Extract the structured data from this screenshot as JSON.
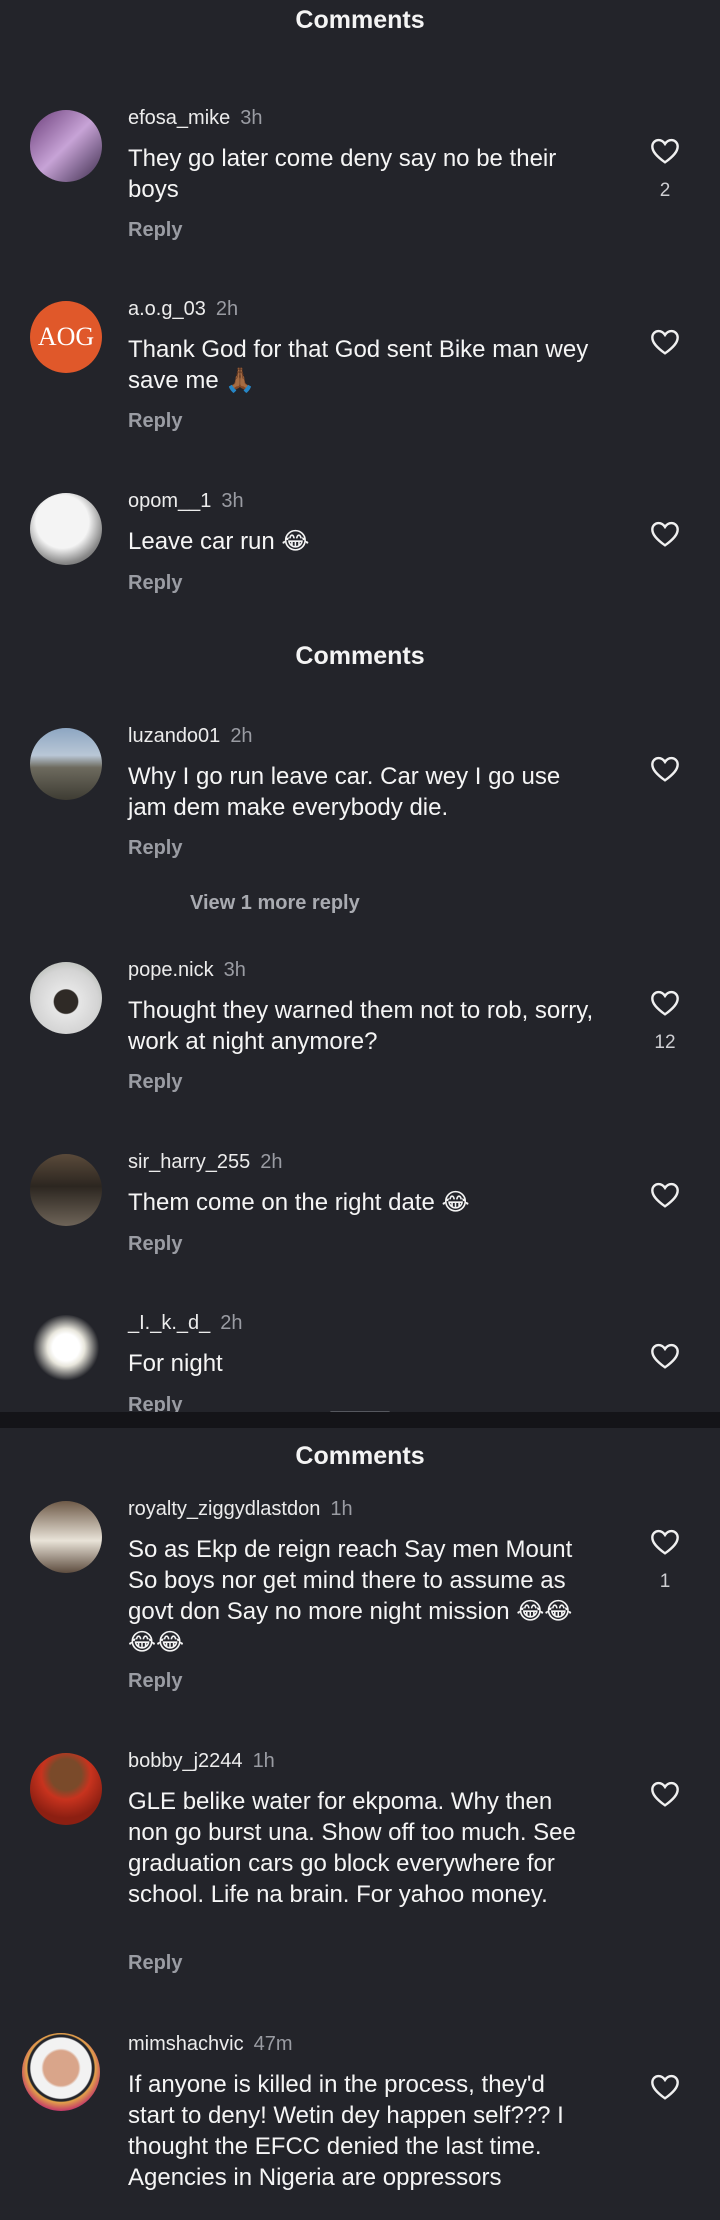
{
  "panels": [
    {
      "title": "Comments",
      "comments": [
        {
          "username": "efosa_mike",
          "time": "3h",
          "text": "They go later come deny say no be their boys",
          "reply": "Reply",
          "likes": "2"
        },
        {
          "username": "a.o.g_03",
          "time": "2h",
          "text": "Thank God for that God sent Bike man wey save me 🙏🏾",
          "reply": "Reply",
          "likes": "",
          "avatar_text": "AOG"
        },
        {
          "username": "opom__1",
          "time": "3h",
          "text": "Leave car run 😂",
          "reply": "Reply",
          "likes": ""
        }
      ]
    },
    {
      "title": "Comments",
      "comments": [
        {
          "username": "luzando01",
          "time": "2h",
          "text": "Why I go run leave car. Car wey I go use jam dem make everybody die.",
          "reply": "Reply",
          "likes": "",
          "more_replies": "View 1 more reply"
        },
        {
          "username": "pope.nick",
          "time": "3h",
          "text": "Thought they warned them not to rob, sorry, work at night anymore?",
          "reply": "Reply",
          "likes": "12"
        },
        {
          "username": "sir_harry_255",
          "time": "2h",
          "text": "Them come on the right date 😂",
          "reply": "Reply",
          "likes": ""
        },
        {
          "username": "_I._k._d_",
          "time": "2h",
          "text": "For night",
          "reply": "Reply",
          "likes": ""
        }
      ]
    },
    {
      "title": "Comments",
      "comments": [
        {
          "username": "royalty_ziggydlastdon",
          "time": "1h",
          "text": "So as Ekp de reign reach Say men Mount So boys nor get mind there to assume as govt don Say no more night mission 😂😂😂😂",
          "reply": "Reply",
          "likes": "1"
        },
        {
          "username": "bobby_j2244",
          "time": "1h",
          "text": "GLE belike water for ekpoma. Why then non go burst una. Show off too much. See graduation cars go block everywhere for school. Life na brain. For yahoo money.",
          "reply": "Reply",
          "likes": ""
        },
        {
          "username": "mimshachvic",
          "time": "47m",
          "text": "If anyone is killed in the process, they'd start to deny! Wetin dey happen self??? I thought the EFCC denied the last time. Agencies in Nigeria are oppressors",
          "reply": "",
          "likes": ""
        }
      ]
    }
  ],
  "colors": {
    "background": "#23242a",
    "muted": "#9a9ca3",
    "aog_avatar": "#e0582a"
  },
  "icons": {
    "like": "heart-outline-icon"
  }
}
